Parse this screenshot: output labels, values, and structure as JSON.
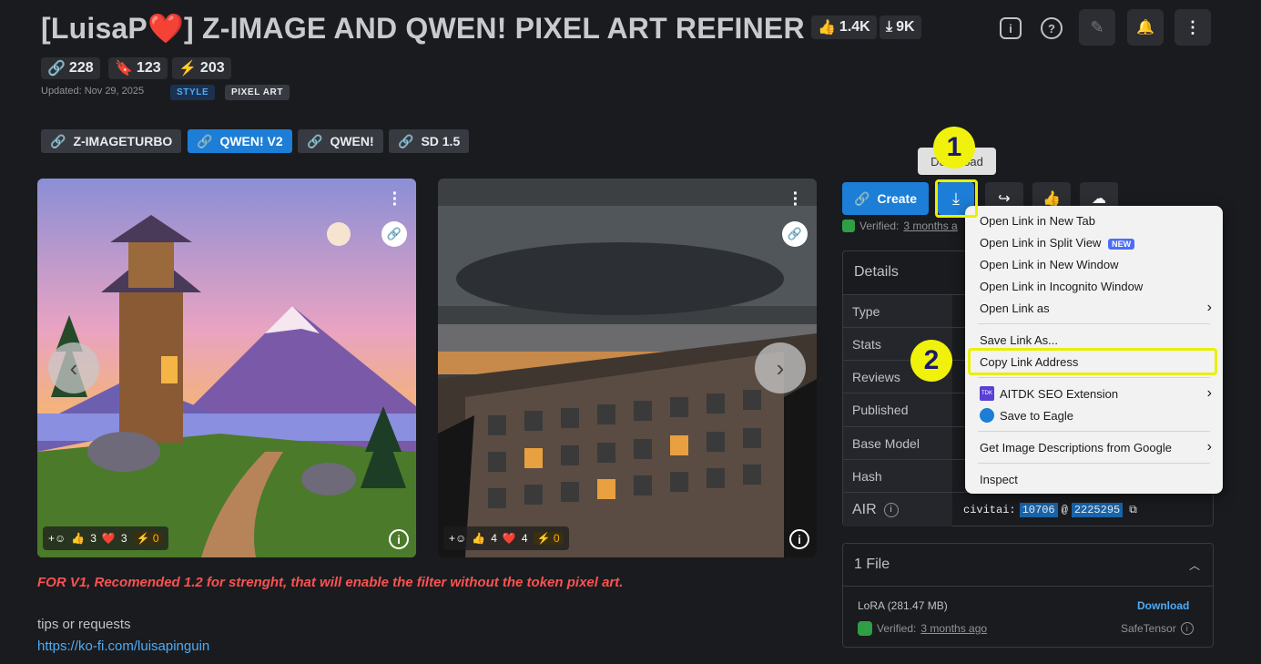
{
  "header": {
    "title_prefix": "[LuisaP",
    "title_suffix": "] Z-IMAGE AND QWEN! PIXEL ART REFINER",
    "likes": "1.4K",
    "downloads": "9K"
  },
  "stats": {
    "links": "228",
    "bookmarks": "123",
    "buzz": "203"
  },
  "meta": {
    "updated": "Updated: Nov 29, 2025",
    "badge_style": "STYLE",
    "badge_pixel": "PIXEL ART"
  },
  "versions": [
    {
      "label": "Z-IMAGETURBO"
    },
    {
      "label": "QWEN! V2"
    },
    {
      "label": "QWEN!"
    },
    {
      "label": "SD 1.5"
    }
  ],
  "images": [
    {
      "thumbs": "3",
      "hearts": "3",
      "buzz": "0"
    },
    {
      "thumbs": "4",
      "hearts": "4",
      "buzz": "0"
    }
  ],
  "description": {
    "highlight": "FOR V1, Recomended 1.2 for strenght, that will enable the filter without the token pixel art.",
    "tips": "tips or requests",
    "link": "https://ko-fi.com/luisapinguin"
  },
  "actions": {
    "create": "Create",
    "tooltip": "Download",
    "verified": "Verified: ",
    "verified_link": "3 months a"
  },
  "details": {
    "title": "Details",
    "rows": [
      "Type",
      "Stats",
      "Reviews",
      "Published",
      "Base Model",
      "Hash"
    ],
    "air_label": "AIR",
    "air_prefix": "civitai:",
    "air_id1": "10706",
    "air_at": "@",
    "air_id2": "2225295"
  },
  "files": {
    "title": "1 File",
    "name": "LoRA (281.47 MB)",
    "download": "Download",
    "verified": "Verified: ",
    "verified_link": "3 months ago",
    "format": "SafeTensor"
  },
  "context_menu": {
    "items": [
      "Open Link in New Tab",
      "Open Link in Split View",
      "Open Link in New Window",
      "Open Link in Incognito Window",
      "Open Link as",
      "Save Link As...",
      "Copy Link Address",
      "AITDK SEO Extension",
      "Save to Eagle",
      "Get Image Descriptions from Google",
      "Inspect"
    ],
    "new_badge": "NEW",
    "aitdk_icon": "TDK"
  },
  "annotations": {
    "one": "1",
    "two": "2"
  },
  "colors": {
    "accent": "#1c7ed6",
    "highlight": "#e8f000",
    "warning_text": "#fa5252",
    "link": "#4dabf7"
  }
}
